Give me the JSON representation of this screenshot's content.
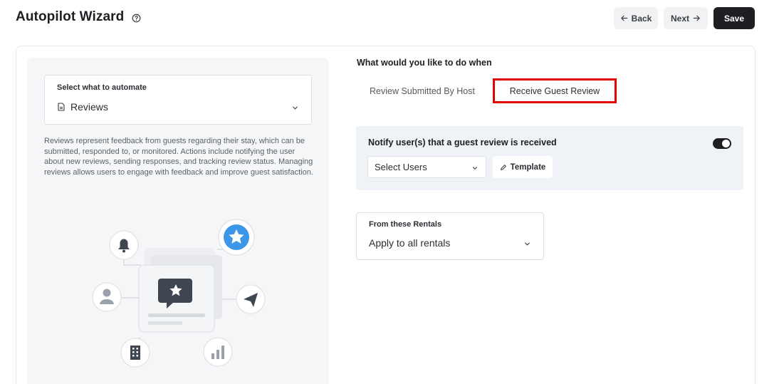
{
  "header": {
    "title": "Autopilot Wizard",
    "back_label": "Back",
    "next_label": "Next",
    "save_label": "Save"
  },
  "left": {
    "automate_label": "Select what to automate",
    "automate_value": "Reviews",
    "description": "Reviews represent feedback from guests regarding their stay, which can be submitted, responded to, or monitored. Actions include notifying the user about new reviews, sending responses, and tracking review status. Managing reviews allows users to engage with feedback and improve guest satisfaction."
  },
  "right": {
    "question": "What would you like to do when",
    "tabs": [
      {
        "label": "Review Submitted By Host",
        "selected": false
      },
      {
        "label": "Receive Guest Review",
        "selected": true
      }
    ],
    "notify": {
      "title": "Notify user(s) that a guest review is received",
      "enabled": true,
      "select_users_placeholder": "Select Users",
      "template_label": "Template"
    },
    "rentals": {
      "label": "From these Rentals",
      "value": "Apply to all rentals"
    }
  },
  "colors": {
    "primary_dark": "#1d1f23",
    "highlight_border": "#e00000",
    "notify_bg": "#eff2f7",
    "left_panel_bg": "#f5f6f7",
    "star_blue": "#3d97e8"
  },
  "icons": [
    "help-circle-icon",
    "arrow-left-icon",
    "arrow-right-icon",
    "document-icon",
    "chevron-down-icon",
    "pencil-icon",
    "bell-icon",
    "star-icon",
    "user-icon",
    "send-icon",
    "building-icon",
    "bar-chart-icon",
    "chat-star-icon"
  ]
}
